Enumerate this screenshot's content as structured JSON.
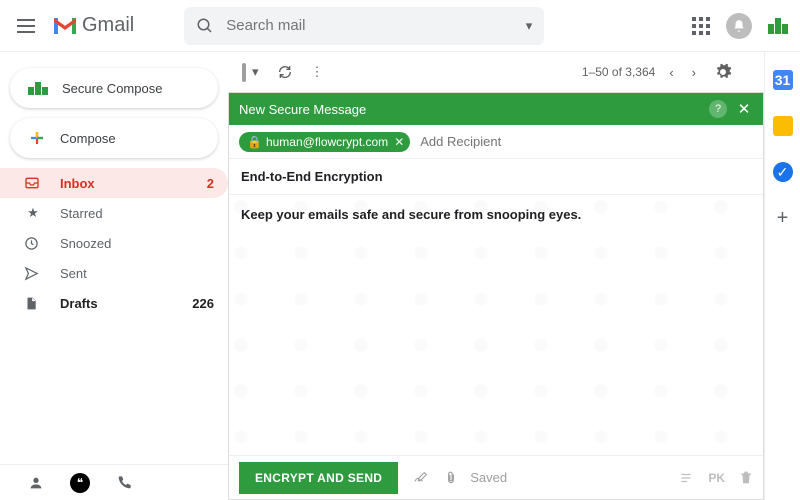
{
  "header": {
    "app_name": "Gmail",
    "search_placeholder": "Search mail"
  },
  "sidebar": {
    "secure_compose": "Secure Compose",
    "compose": "Compose",
    "items": [
      {
        "label": "Inbox",
        "count": "2"
      },
      {
        "label": "Starred"
      },
      {
        "label": "Snoozed"
      },
      {
        "label": "Sent"
      },
      {
        "label": "Drafts",
        "count": "226"
      }
    ]
  },
  "toolbar": {
    "page_count": "1–50 of 3,364"
  },
  "compose": {
    "title": "New Secure Message",
    "recipient": "human@flowcrypt.com",
    "add_recipient_placeholder": "Add Recipient",
    "subject": "End-to-End Encryption",
    "body": "Keep your emails safe and secure from snooping eyes.",
    "send_label": "ENCRYPT AND SEND",
    "status": "Saved",
    "pk_label": "PK"
  },
  "rail": {
    "calendar_day": "31"
  },
  "colors": {
    "brand_green": "#2e9c3e",
    "gmail_red": "#d93025"
  }
}
